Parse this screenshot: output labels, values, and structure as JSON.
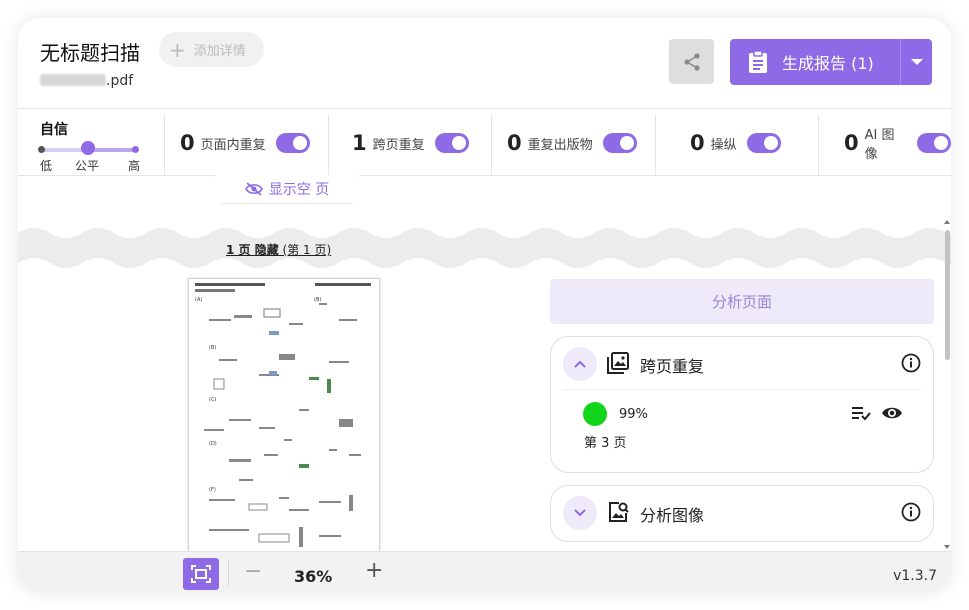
{
  "header": {
    "title": "无标题扫描",
    "add_details": "添加详情",
    "filename_suffix": ".pdf",
    "report_label": "生成报告 (1)"
  },
  "confidence": {
    "label": "自信",
    "low": "低",
    "fair": "公平",
    "high": "高",
    "level": "fair"
  },
  "filters": [
    {
      "count": "0",
      "label": "页面内重复",
      "enabled": true
    },
    {
      "count": "1",
      "label": "跨页重复",
      "enabled": true
    },
    {
      "count": "0",
      "label": "重复出版物",
      "enabled": true
    },
    {
      "count": "0",
      "label": "操纵",
      "enabled": true
    },
    {
      "count": "0",
      "label": "AI 图像",
      "enabled": true
    }
  ],
  "show_empty": "显示空 页",
  "hidden_notice": {
    "bold": "1 页 隐藏",
    "rest": " (第 1 页)"
  },
  "right_panel": {
    "analyze_label": "分析页面",
    "cross_page": {
      "title": "跨页重复",
      "percent": "99%",
      "page_ref": "第 3 页",
      "status_color": "#12d41a"
    },
    "analyze_image": {
      "title": "分析图像"
    }
  },
  "footer": {
    "zoom": "36%",
    "version": "v1.3.7"
  },
  "colors": {
    "accent": "#8e6ae6",
    "accent_light": "#eeeaf9"
  }
}
